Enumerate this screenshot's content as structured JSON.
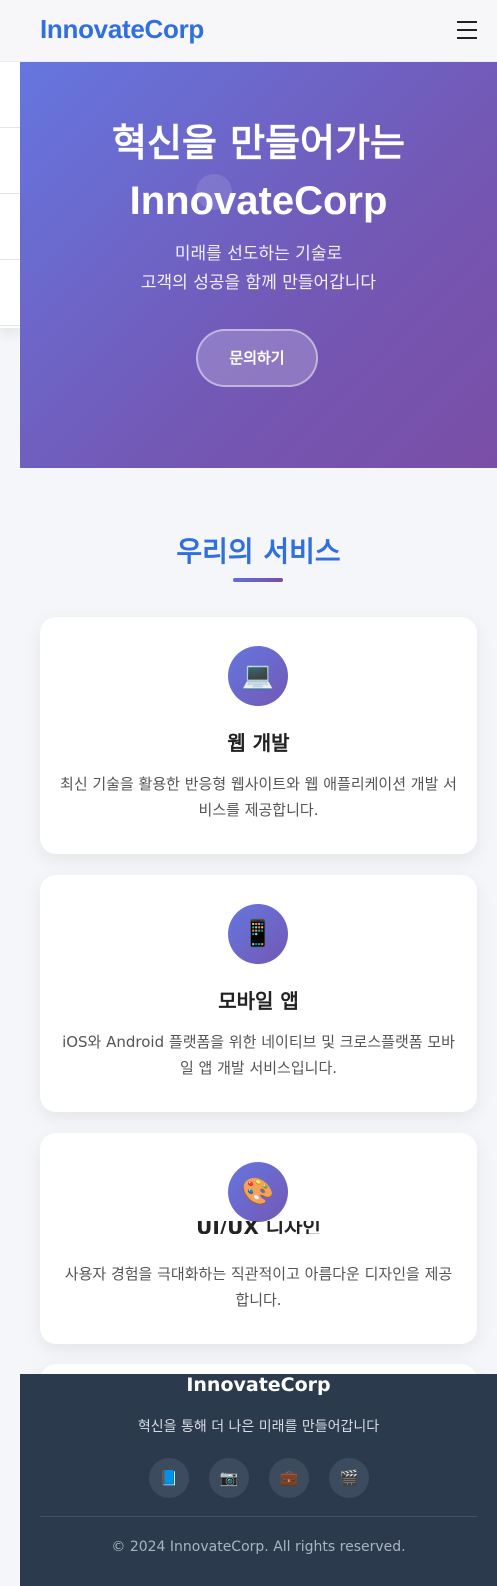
{
  "header": {
    "logo": "InnovateCorp",
    "menu_icon": "hamburger-menu-icon"
  },
  "hero": {
    "title_line1": "혁신을 만들어가는",
    "title_line2": "InnovateCorp",
    "subtitle_line1": "미래를 선도하는 기술로",
    "subtitle_line2": "고객의 성공을 함께 만들어갑니다",
    "cta_label": "문의하기"
  },
  "services": {
    "title": "우리의 서비스",
    "cards": [
      {
        "icon": "laptop-icon",
        "icon_glyph": "💻",
        "title": "웹 개발",
        "description": "최신 기술을 활용한 반응형 웹사이트와 웹 애플리케이션 개발 서비스를 제공합니다."
      },
      {
        "icon": "mobile-phone-icon",
        "icon_glyph": "📱",
        "title": "모바일 앱",
        "description": "iOS와 Android 플랫폼을 위한 네이티브 및 크로스플랫폼 모바일 앱 개발 서비스입니다."
      },
      {
        "icon": "palette-icon",
        "icon_glyph": "🎨",
        "title": "UI/UX 디자인",
        "description": "사용자 경험을 극대화하는 직관적이고 아름다운 디자인을 제공합니다."
      }
    ]
  },
  "footer": {
    "brand": "InnovateCorp",
    "tagline": "혁신을 통해 더 나은 미래를 만들어갑니다",
    "social": [
      {
        "icon": "book-icon",
        "glyph": "📘"
      },
      {
        "icon": "camera-icon",
        "glyph": "📷"
      },
      {
        "icon": "briefcase-icon",
        "glyph": "💼"
      },
      {
        "icon": "video-camera-icon",
        "glyph": "🎬"
      }
    ],
    "copyright": "© 2024 InnovateCorp. All rights reserved."
  },
  "colors": {
    "brand": "#2f6fe0",
    "hero_gradient_start": "#6576df",
    "hero_gradient_end": "#7a4ea6",
    "footer_bg": "#2c3a4d"
  }
}
